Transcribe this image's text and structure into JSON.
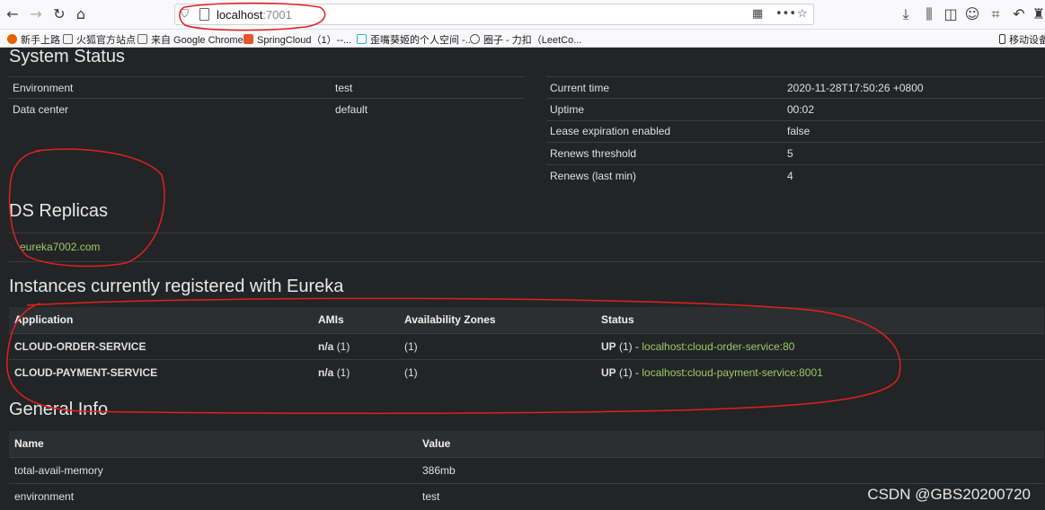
{
  "browser": {
    "url_host": "localhost",
    "url_port": ":7001",
    "bookmarks": [
      {
        "label": "新手上路",
        "icon": "firefox-icon"
      },
      {
        "label": "火狐官方站点",
        "icon": "folder-icon"
      },
      {
        "label": "来自 Google Chrome",
        "icon": "folder-icon"
      },
      {
        "label": "SpringCloud（1）--...",
        "icon": "csdn-icon"
      },
      {
        "label": "歪嘴葵姬的个人空间 -...",
        "icon": "bilibili-icon"
      },
      {
        "label": "圈子 - 力扣（LeetCo...",
        "icon": "globe-icon"
      }
    ],
    "mobile_bookmarks": "移动设备",
    "accent": "#d00000"
  },
  "system_status": {
    "title": "System Status",
    "left_rows": [
      {
        "name": "Environment",
        "value": "test"
      },
      {
        "name": "Data center",
        "value": "default"
      }
    ],
    "right_rows": [
      {
        "name": "Current time",
        "value": "2020-11-28T17:50:26 +0800"
      },
      {
        "name": "Uptime",
        "value": "00:02"
      },
      {
        "name": "Lease expiration enabled",
        "value": "false"
      },
      {
        "name": "Renews threshold",
        "value": "5"
      },
      {
        "name": "Renews (last min)",
        "value": "4"
      }
    ]
  },
  "ds_replicas": {
    "title": "DS Replicas",
    "items": [
      "eureka7002.com"
    ]
  },
  "instances": {
    "title": "Instances currently registered with Eureka",
    "headers": [
      "Application",
      "AMIs",
      "Availability Zones",
      "Status"
    ],
    "rows": [
      {
        "application": "CLOUD-ORDER-SERVICE",
        "amis": "n/a",
        "amis_count": "(1)",
        "zones": "(1)",
        "status_prefix": "UP",
        "status_count": "(1) - ",
        "status_link": "localhost:cloud-order-service:80"
      },
      {
        "application": "CLOUD-PAYMENT-SERVICE",
        "amis": "n/a",
        "amis_count": "(1)",
        "zones": "(1)",
        "status_prefix": "UP",
        "status_count": "(1) - ",
        "status_link": "localhost:cloud-payment-service:8001"
      }
    ]
  },
  "general_info": {
    "title": "General Info",
    "headers": [
      "Name",
      "Value"
    ],
    "rows": [
      {
        "name": "total-avail-memory",
        "value": "386mb"
      },
      {
        "name": "environment",
        "value": "test"
      }
    ]
  },
  "watermark": "CSDN @GBS20200720"
}
